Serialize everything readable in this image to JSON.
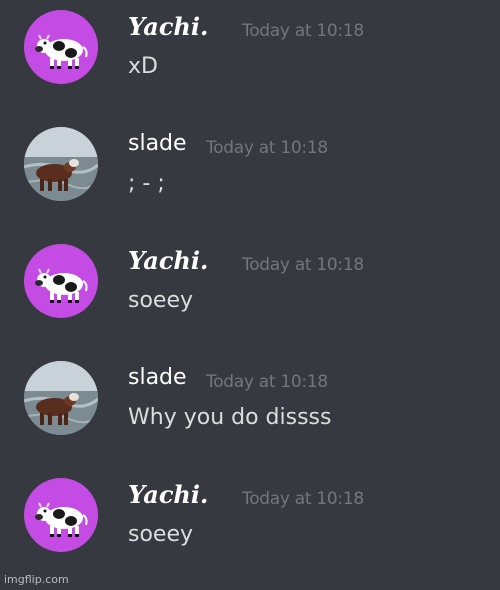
{
  "messages": [
    {
      "username": "Yachi.",
      "timestamp": "Today at 10:18",
      "content": "xD",
      "avatar": "cow-pink-avatar",
      "username_color": "#ffffff"
    },
    {
      "username": "slade",
      "timestamp": "Today at 10:18",
      "content": "; - ;",
      "avatar": "cow-photo-avatar",
      "username_color": "#ffffff"
    },
    {
      "username": "Yachi.",
      "timestamp": "Today at 10:18",
      "content": "soeey",
      "avatar": "cow-pink-avatar",
      "username_color": "#ffffff"
    },
    {
      "username": "slade",
      "timestamp": "Today at 10:18",
      "content": "Why you do dissss",
      "avatar": "cow-photo-avatar",
      "username_color": "#ffffff"
    },
    {
      "username": "Yachi.",
      "timestamp": "Today at 10:18",
      "content": "soeey",
      "avatar": "cow-pink-avatar",
      "username_color": "#ffffff"
    }
  ],
  "watermark": "imgflip.com",
  "colors": {
    "background": "#36393f",
    "timestamp": "#72767d",
    "message_text": "#dcddde",
    "pink_avatar": "#c44ce4"
  }
}
